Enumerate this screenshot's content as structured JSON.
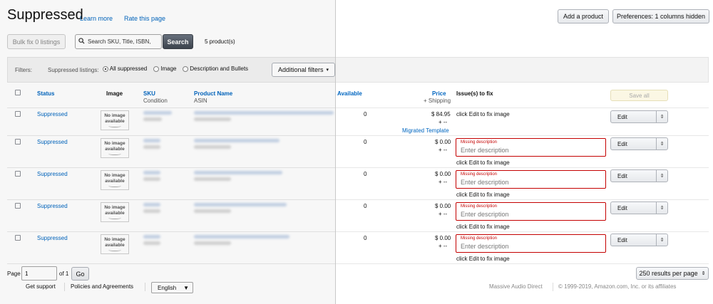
{
  "header": {
    "title": "Suppressed",
    "learn_more": "Learn more",
    "rate_page": "Rate this page",
    "add_product": "Add a product",
    "preferences": "Preferences: 1 columns hidden"
  },
  "toolbar": {
    "bulk_fix": "Bulk fix 0 listings",
    "search_placeholder": "Search SKU, Title, ISBN,",
    "search_button": "Search",
    "product_count": "5 product(s)"
  },
  "filters": {
    "label": "Filters:",
    "suppressed_label": "Suppressed listings:",
    "options": [
      "All suppressed",
      "Image",
      "Description and Bullets"
    ],
    "selected": "All suppressed",
    "additional": "Additional filters"
  },
  "table": {
    "headers": {
      "status": "Status",
      "image": "Image",
      "sku": "SKU",
      "condition": "Condition",
      "product_name": "Product Name",
      "asin": "ASIN",
      "available": "Available",
      "price": "Price",
      "shipping": "+ Shipping",
      "issues": "Issue(s) to fix",
      "save_all": "Save all"
    },
    "no_image_text": "No image available",
    "rows": [
      {
        "status": "Suppressed",
        "available": "0",
        "price": "$ 84.95",
        "shipping": "+ --",
        "extra": "Migrated Template",
        "issue_label": "",
        "issue_placeholder": "",
        "fix_text": "click Edit to fix image",
        "edit": "Edit"
      },
      {
        "status": "Suppressed",
        "available": "0",
        "price": "$ 0.00",
        "shipping": "+ --",
        "issue_label": "Missing description",
        "issue_placeholder": "Enter description",
        "fix_text": "click Edit to fix image",
        "edit": "Edit"
      },
      {
        "status": "Suppressed",
        "available": "0",
        "price": "$ 0.00",
        "shipping": "+ --",
        "issue_label": "Missing description",
        "issue_placeholder": "Enter description",
        "fix_text": "click Edit to fix image",
        "edit": "Edit"
      },
      {
        "status": "Suppressed",
        "available": "0",
        "price": "$ 0.00",
        "shipping": "+ --",
        "issue_label": "Missing description",
        "issue_placeholder": "Enter description",
        "fix_text": "click Edit to fix image",
        "edit": "Edit"
      },
      {
        "status": "Suppressed",
        "available": "0",
        "price": "$ 0.00",
        "shipping": "+ --",
        "issue_label": "Missing description",
        "issue_placeholder": "Enter description",
        "fix_text": "click Edit to fix image",
        "edit": "Edit"
      }
    ]
  },
  "pagination": {
    "page_label": "Page",
    "page_value": "1",
    "of_label": "of 1",
    "go": "Go",
    "per_page": "250 results per page"
  },
  "footer": {
    "get_support": "Get support",
    "policies": "Policies and Agreements",
    "language": "English",
    "seller": "Massive Audio Direct",
    "copyright": "© 1999-2019, Amazon.com, Inc. or its affiliates"
  }
}
